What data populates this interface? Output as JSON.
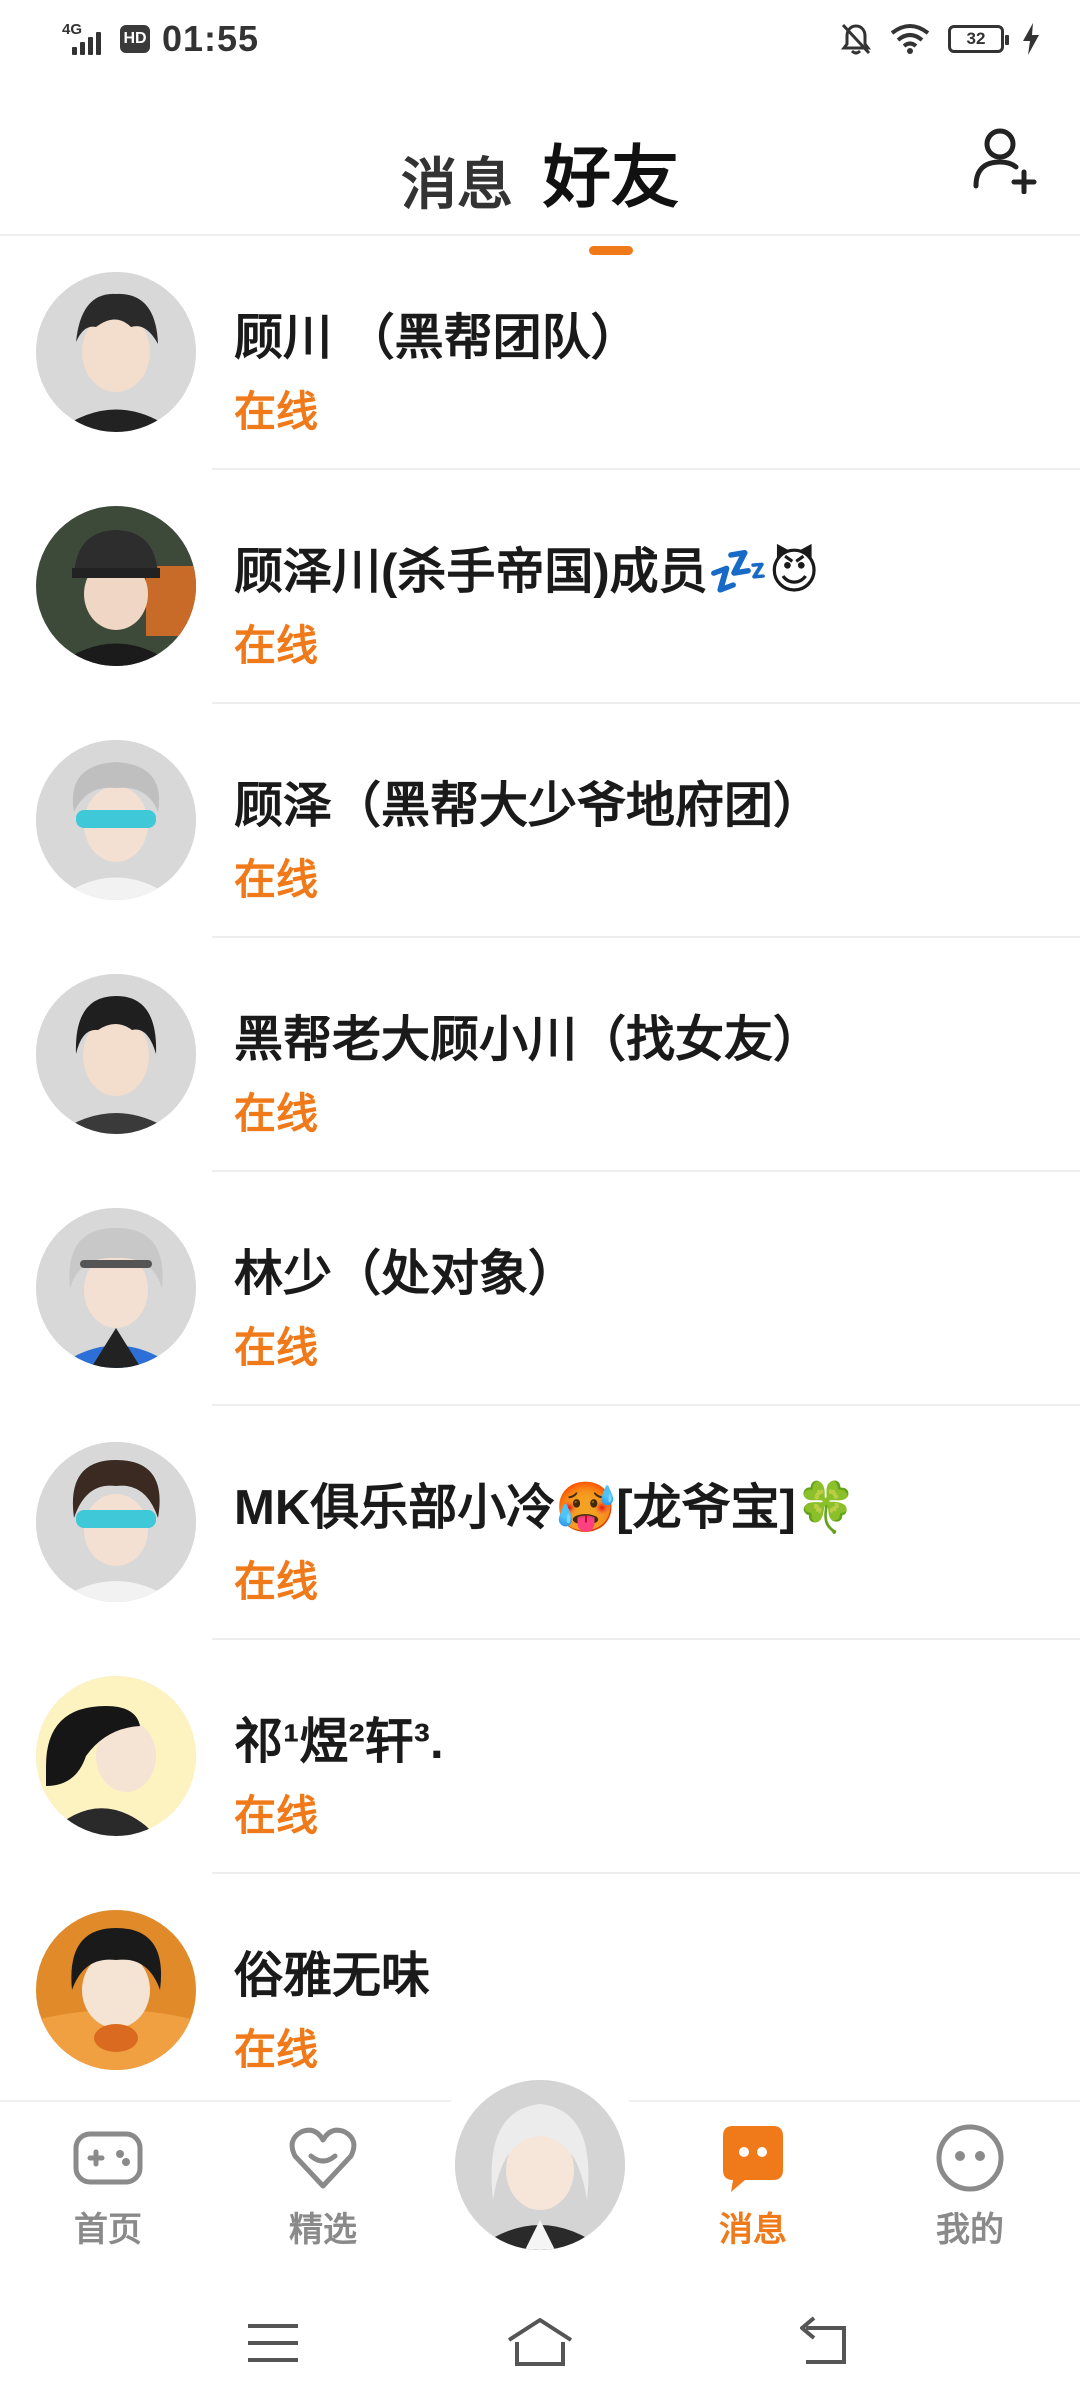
{
  "status_bar": {
    "network": "4G",
    "hd": "HD",
    "time": "01:55",
    "battery": "32"
  },
  "header": {
    "tab_messages": "消息",
    "tab_friends": "好友"
  },
  "friends": [
    {
      "name": "顾川  （黑帮团队）",
      "status": "在线"
    },
    {
      "name": "顾泽川(杀手帝国)成员💤😈",
      "status": "在线"
    },
    {
      "name": "顾泽（黑帮大少爷地府团）",
      "status": "在线"
    },
    {
      "name": "黑帮老大顾小川（找女友）",
      "status": "在线"
    },
    {
      "name": "林少（处对象）",
      "status": "在线"
    },
    {
      "name": "MK俱乐部小冷🥵[龙爷宝]🍀",
      "status": "在线"
    },
    {
      "name": "祁¹煜²轩³.",
      "status": "在线"
    },
    {
      "name": "俗雅无味",
      "status": "在线"
    }
  ],
  "bottom_nav": {
    "home": "首页",
    "featured": "精选",
    "messages": "消息",
    "mine": "我的"
  },
  "colors": {
    "accent": "#f07a1a",
    "text": "#1a1a1a",
    "nav_inactive": "#8a8a8a"
  }
}
